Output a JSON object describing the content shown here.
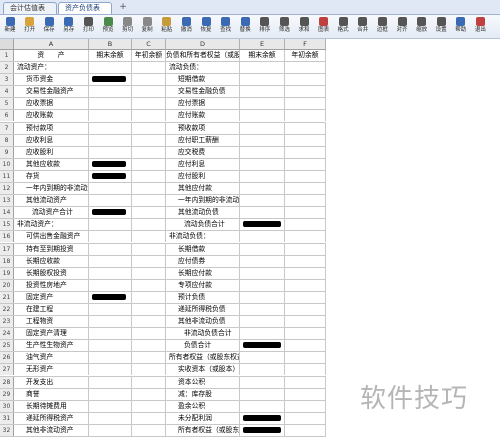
{
  "tabs": [
    {
      "label": "会计估值表",
      "active": false
    },
    {
      "label": "资产负债表",
      "active": true
    }
  ],
  "toolbar": [
    {
      "label": "新建",
      "color": "#3a6ab3"
    },
    {
      "label": "打开",
      "color": "#d9a23a"
    },
    {
      "label": "保存",
      "color": "#3a6ab3"
    },
    {
      "label": "另存",
      "color": "#3a6ab3"
    },
    {
      "label": "打印",
      "color": "#555555"
    },
    {
      "label": "预览",
      "color": "#4a8a4a"
    },
    {
      "label": "剪切",
      "color": "#888888"
    },
    {
      "label": "复制",
      "color": "#888888"
    },
    {
      "label": "粘贴",
      "color": "#c79a3a"
    },
    {
      "label": "撤消",
      "color": "#3a6ab3"
    },
    {
      "label": "恢复",
      "color": "#3a6ab3"
    },
    {
      "label": "查找",
      "color": "#3a6ab3"
    },
    {
      "label": "替换",
      "color": "#3a6ab3"
    },
    {
      "label": "排序",
      "color": "#555555"
    },
    {
      "label": "筛选",
      "color": "#555555"
    },
    {
      "label": "求和",
      "color": "#555555"
    },
    {
      "label": "图表",
      "color": "#c04040"
    },
    {
      "label": "格式",
      "color": "#555555"
    },
    {
      "label": "合并",
      "color": "#555555"
    },
    {
      "label": "边框",
      "color": "#555555"
    },
    {
      "label": "对齐",
      "color": "#555555"
    },
    {
      "label": "缩放",
      "color": "#555555"
    },
    {
      "label": "设置",
      "color": "#555555"
    },
    {
      "label": "帮助",
      "color": "#3a6ab3"
    },
    {
      "label": "退出",
      "color": "#c04040"
    }
  ],
  "columns": [
    "A",
    "B",
    "C",
    "D",
    "E",
    "F"
  ],
  "rows": [
    {
      "n": "1",
      "a": "资　　产",
      "b": "期末余额",
      "c": "年初余额",
      "d": "负债和所有者权益（或股东权益）",
      "e": "期末余额",
      "f": "年初余额",
      "header": true
    },
    {
      "n": "2",
      "a": "流动资产：",
      "b": "",
      "c": "",
      "d": "流动负债：",
      "e": "",
      "f": ""
    },
    {
      "n": "3",
      "a": "货币资金",
      "b": "",
      "c": "",
      "d": "短期借款",
      "e": "",
      "f": "",
      "ia": true,
      "id": true,
      "rb": true
    },
    {
      "n": "4",
      "a": "交易性金融资产",
      "b": "",
      "c": "",
      "d": "交易性金融负债",
      "e": "",
      "f": "",
      "ia": true,
      "id": true
    },
    {
      "n": "5",
      "a": "应收票据",
      "b": "",
      "c": "",
      "d": "应付票据",
      "e": "",
      "f": "",
      "ia": true,
      "id": true
    },
    {
      "n": "6",
      "a": "应收账款",
      "b": "",
      "c": "",
      "d": "应付账款",
      "e": "",
      "f": "",
      "ia": true,
      "id": true
    },
    {
      "n": "7",
      "a": "预付款项",
      "b": "",
      "c": "",
      "d": "预收款项",
      "e": "",
      "f": "",
      "ia": true,
      "id": true
    },
    {
      "n": "8",
      "a": "应收利息",
      "b": "",
      "c": "",
      "d": "应付职工薪酬",
      "e": "",
      "f": "",
      "ia": true,
      "id": true
    },
    {
      "n": "9",
      "a": "应收股利",
      "b": "",
      "c": "",
      "d": "应交税费",
      "e": "",
      "f": "",
      "ia": true,
      "id": true
    },
    {
      "n": "10",
      "a": "其他应收款",
      "b": "",
      "c": "",
      "d": "应付利息",
      "e": "",
      "f": "",
      "ia": true,
      "id": true,
      "rb": true
    },
    {
      "n": "11",
      "a": "存货",
      "b": "",
      "c": "",
      "d": "应付股利",
      "e": "",
      "f": "",
      "ia": true,
      "id": true,
      "rb": true
    },
    {
      "n": "12",
      "a": "一年内到期的非流动资产",
      "b": "",
      "c": "",
      "d": "其他应付款",
      "e": "",
      "f": "",
      "ia": true,
      "id": true
    },
    {
      "n": "13",
      "a": "其他流动资产",
      "b": "",
      "c": "",
      "d": "一年内到期的非流动负债",
      "e": "",
      "f": "",
      "ia": true,
      "id": true
    },
    {
      "n": "14",
      "a": "流动资产合计",
      "b": "",
      "c": "",
      "d": "其他流动负债",
      "e": "",
      "f": "",
      "ia2": true,
      "id": true,
      "rb": true
    },
    {
      "n": "15",
      "a": "非流动资产：",
      "b": "",
      "c": "",
      "d": "流动负债合计",
      "e": "",
      "f": "",
      "id2": true,
      "re": true
    },
    {
      "n": "16",
      "a": "可供出售金融资产",
      "b": "",
      "c": "",
      "d": "非流动负债：",
      "e": "",
      "f": "",
      "ia": true
    },
    {
      "n": "17",
      "a": "持有至到期投资",
      "b": "",
      "c": "",
      "d": "长期借款",
      "e": "",
      "f": "",
      "ia": true,
      "id": true
    },
    {
      "n": "18",
      "a": "长期应收款",
      "b": "",
      "c": "",
      "d": "应付债券",
      "e": "",
      "f": "",
      "ia": true,
      "id": true
    },
    {
      "n": "19",
      "a": "长期股权投资",
      "b": "",
      "c": "",
      "d": "长期应付款",
      "e": "",
      "f": "",
      "ia": true,
      "id": true
    },
    {
      "n": "20",
      "a": "投资性房地产",
      "b": "",
      "c": "",
      "d": "专项应付款",
      "e": "",
      "f": "",
      "ia": true,
      "id": true
    },
    {
      "n": "21",
      "a": "固定资产",
      "b": "",
      "c": "",
      "d": "预计负债",
      "e": "",
      "f": "",
      "ia": true,
      "id": true,
      "rb": true
    },
    {
      "n": "22",
      "a": "在建工程",
      "b": "",
      "c": "",
      "d": "递延所得税负债",
      "e": "",
      "f": "",
      "ia": true,
      "id": true
    },
    {
      "n": "23",
      "a": "工程物资",
      "b": "",
      "c": "",
      "d": "其他非流动负债",
      "e": "",
      "f": "",
      "ia": true,
      "id": true
    },
    {
      "n": "24",
      "a": "固定资产清理",
      "b": "",
      "c": "",
      "d": "非流动负债合计",
      "e": "",
      "f": "",
      "ia": true,
      "id2": true
    },
    {
      "n": "25",
      "a": "生产性生物资产",
      "b": "",
      "c": "",
      "d": "负债合计",
      "e": "",
      "f": "",
      "ia": true,
      "id2": true,
      "re": true
    },
    {
      "n": "26",
      "a": "油气资产",
      "b": "",
      "c": "",
      "d": "所有者权益（或股东权益）：",
      "e": "",
      "f": "",
      "ia": true
    },
    {
      "n": "27",
      "a": "无形资产",
      "b": "",
      "c": "",
      "d": "实收资本（或股本）",
      "e": "",
      "f": "",
      "ia": true,
      "id": true
    },
    {
      "n": "28",
      "a": "开发支出",
      "b": "",
      "c": "",
      "d": "资本公积",
      "e": "",
      "f": "",
      "ia": true,
      "id": true
    },
    {
      "n": "29",
      "a": "商誉",
      "b": "",
      "c": "",
      "d": "减：库存股",
      "e": "",
      "f": "",
      "ia": true,
      "id": true
    },
    {
      "n": "30",
      "a": "长期待摊费用",
      "b": "",
      "c": "",
      "d": "盈余公积",
      "e": "",
      "f": "",
      "ia": true,
      "id": true
    },
    {
      "n": "31",
      "a": "递延所得税资产",
      "b": "",
      "c": "",
      "d": "未分配利润",
      "e": "",
      "f": "",
      "ia": true,
      "id": true,
      "re": true
    },
    {
      "n": "32",
      "a": "其他非流动资产",
      "b": "",
      "c": "",
      "d": "所有者权益（或股东权益）合计",
      "e": "",
      "f": "",
      "ia": true,
      "id": true,
      "re": true
    }
  ],
  "watermark": "软件技巧"
}
